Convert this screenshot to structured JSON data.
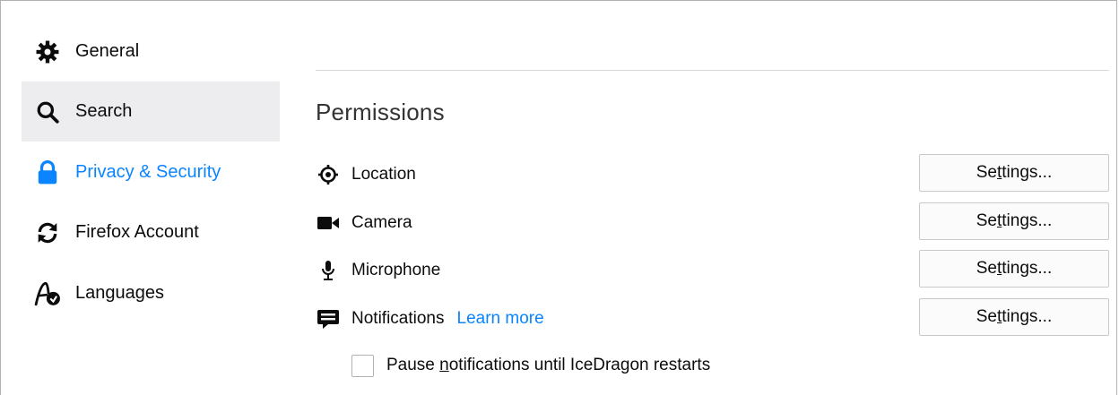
{
  "sidebar": {
    "items": [
      {
        "label": "General",
        "icon": "gear-icon"
      },
      {
        "label": "Search",
        "icon": "search-icon"
      },
      {
        "label": "Privacy & Security",
        "icon": "lock-icon"
      },
      {
        "label": "Firefox Account",
        "icon": "sync-icon"
      },
      {
        "label": "Languages",
        "icon": "languages-icon"
      }
    ],
    "selected": "Privacy & Security",
    "hovered": "Search",
    "accent_color": "#0a84ff"
  },
  "permissions": {
    "title": "Permissions",
    "rows": [
      {
        "label": "Location",
        "icon": "location-icon",
        "button": {
          "pre": "Se",
          "underline": "t",
          "post": "tings..."
        }
      },
      {
        "label": "Camera",
        "icon": "camera-icon",
        "button": {
          "pre": "Se",
          "underline": "t",
          "post": "tings..."
        }
      },
      {
        "label": "Microphone",
        "icon": "microphone-icon",
        "button": {
          "pre": "Se",
          "underline": "t",
          "post": "tings..."
        }
      },
      {
        "label": "Notifications",
        "icon": "notifications-icon",
        "learn_more": "Learn more",
        "button": {
          "pre": "Se",
          "underline": "t",
          "post": "tings..."
        }
      }
    ],
    "pause_notifications": {
      "pre": "Pause ",
      "underline": "n",
      "post": "otifications until IceDragon restarts",
      "checked": false
    }
  }
}
